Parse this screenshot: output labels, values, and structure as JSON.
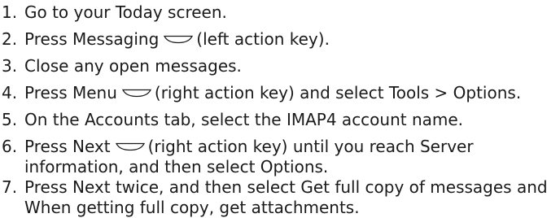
{
  "steps": [
    {
      "number": "1.",
      "text": "Go to your Today screen."
    },
    {
      "number": "2.",
      "before": "Press Messaging",
      "icon": "left-action-key-icon",
      "after": "(left action key)."
    },
    {
      "number": "3.",
      "text": "Close any open messages."
    },
    {
      "number": "4.",
      "before": "Press Menu",
      "icon": "right-action-key-icon",
      "after": "(right action key) and select Tools > Options."
    },
    {
      "number": "5.",
      "text": "On the Accounts tab, select the IMAP4 account name."
    },
    {
      "number": "6.",
      "before": "Press Next",
      "icon": "right-action-key-icon",
      "after": "(right action key) until you reach Server",
      "line2": "information, and then select Options."
    },
    {
      "number": "7.",
      "line1": "Press Next twice, and then select Get full copy of messages and",
      "line2": "When getting full copy, get attachments."
    }
  ]
}
